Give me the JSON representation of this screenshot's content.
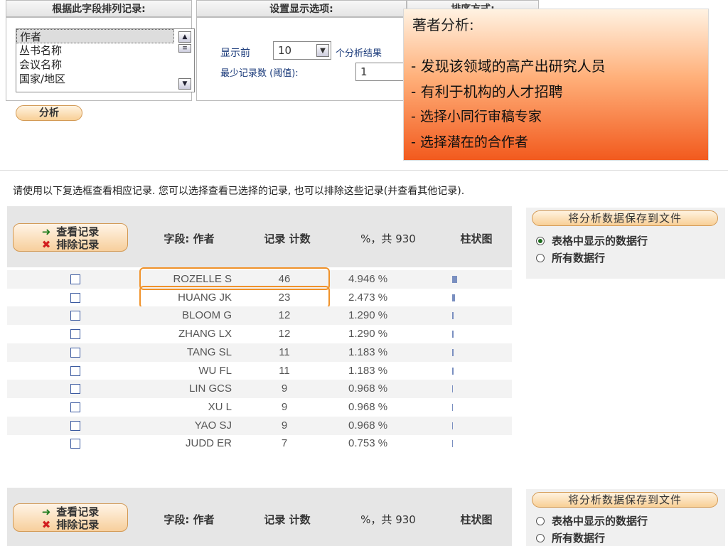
{
  "top_panel": {
    "sort_field_header": "根据此字段排列记录:",
    "display_options_header": "设置显示选项:",
    "sort_order_header": "排序方式:",
    "field_list": [
      "作者",
      "丛书名称",
      "会议名称",
      "国家/地区"
    ],
    "show_top_label": "显示前",
    "show_top_value": "10",
    "show_top_suffix": "个分析结果",
    "min_records_label": "最少记录数 (阈值):",
    "min_records_value": "1",
    "analyze_button": "分析"
  },
  "callout": {
    "title": "著者分析:",
    "points": [
      {
        "bullet": "-",
        "text": "发现该领域的高产出研究人员"
      },
      {
        "bullet": "-",
        "text": "有利于机构的人才招聘"
      },
      {
        "bullet": "-",
        "text": "选择小同行审稿专家"
      },
      {
        "bullet": "-",
        "text": "选择潜在的合作者"
      }
    ],
    "colors": {
      "top": "#fff2e2",
      "bottom": "#f25a1e"
    }
  },
  "instructions": "请使用以下复选框查看相应记录. 您可以选择查看已选择的记录, 也可以排除这些记录(并查看其他记录).",
  "table": {
    "view_records_button": "查看记录",
    "exclude_records_button": "排除记录",
    "columns": [
      "字段: 作者",
      "记录 计数",
      "%，共 930",
      "柱状图"
    ],
    "save_button": "将分析数据保存到文件",
    "save_options_top": [
      "表格中显示的数据行",
      "所有数据行"
    ],
    "save_options_top_selected": 0,
    "save_options_bottom": [
      "表格中显示的数据行",
      "所有数据行"
    ],
    "rows": [
      {
        "author": "ROZELLE S",
        "count": "46",
        "percent": "4.946 %",
        "bar": 0.4946
      },
      {
        "author": "HUANG JK",
        "count": "23",
        "percent": "2.473 %",
        "bar": 0.2473
      },
      {
        "author": "BLOOM G",
        "count": "12",
        "percent": "1.290 %",
        "bar": 0.129
      },
      {
        "author": "ZHANG LX",
        "count": "12",
        "percent": "1.290 %",
        "bar": 0.129
      },
      {
        "author": "TANG SL",
        "count": "11",
        "percent": "1.183 %",
        "bar": 0.1183
      },
      {
        "author": "WU FL",
        "count": "11",
        "percent": "1.183 %",
        "bar": 0.1183
      },
      {
        "author": "LIN GCS",
        "count": "9",
        "percent": "0.968 %",
        "bar": 0.0968
      },
      {
        "author": "XU L",
        "count": "9",
        "percent": "0.968 %",
        "bar": 0.0968
      },
      {
        "author": "YAO SJ",
        "count": "9",
        "percent": "0.968 %",
        "bar": 0.0968
      },
      {
        "author": "JUDD ER",
        "count": "7",
        "percent": "0.753 %",
        "bar": 0.0753
      }
    ],
    "highlighted_rows": [
      0,
      1
    ],
    "highlight_color": "#f0922a",
    "bar_color": "#7a8fc0"
  }
}
